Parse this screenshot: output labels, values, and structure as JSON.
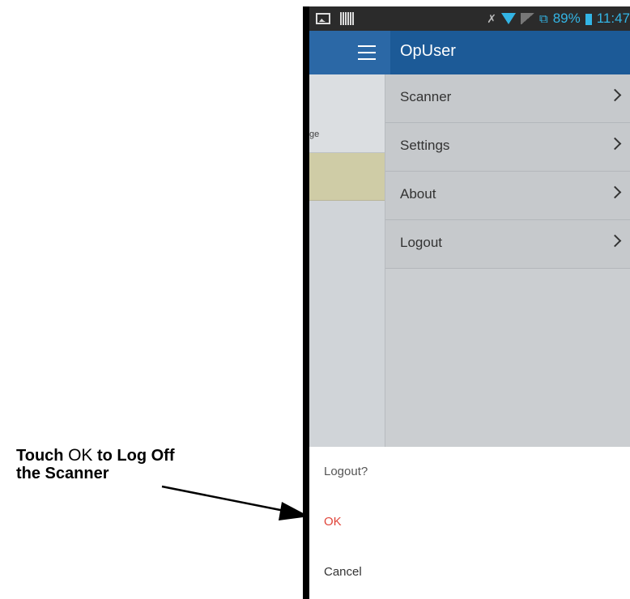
{
  "callout": {
    "line1_prefix": "Touch ",
    "line1_ok": "OK",
    "line1_suffix": " to Log Off",
    "line2": "the Scanner"
  },
  "status_bar": {
    "battery": "89%",
    "time": "11:47",
    "icons": [
      "image-icon",
      "barcode-icon",
      "mute-icon",
      "wifi-icon",
      "signal-icon",
      "network-icon",
      "battery-icon"
    ],
    "accent_color": "#33b5e5"
  },
  "app_bar": {
    "title": "OpUser",
    "background": "#1c5a97"
  },
  "behind_content": {
    "partial_text": "ge"
  },
  "drawer": {
    "items": [
      {
        "label": "Scanner"
      },
      {
        "label": "Settings"
      },
      {
        "label": "About"
      },
      {
        "label": "Logout"
      }
    ]
  },
  "dialog": {
    "title": "Logout?",
    "ok_label": "OK",
    "cancel_label": "Cancel",
    "ok_color": "#e0453a"
  }
}
